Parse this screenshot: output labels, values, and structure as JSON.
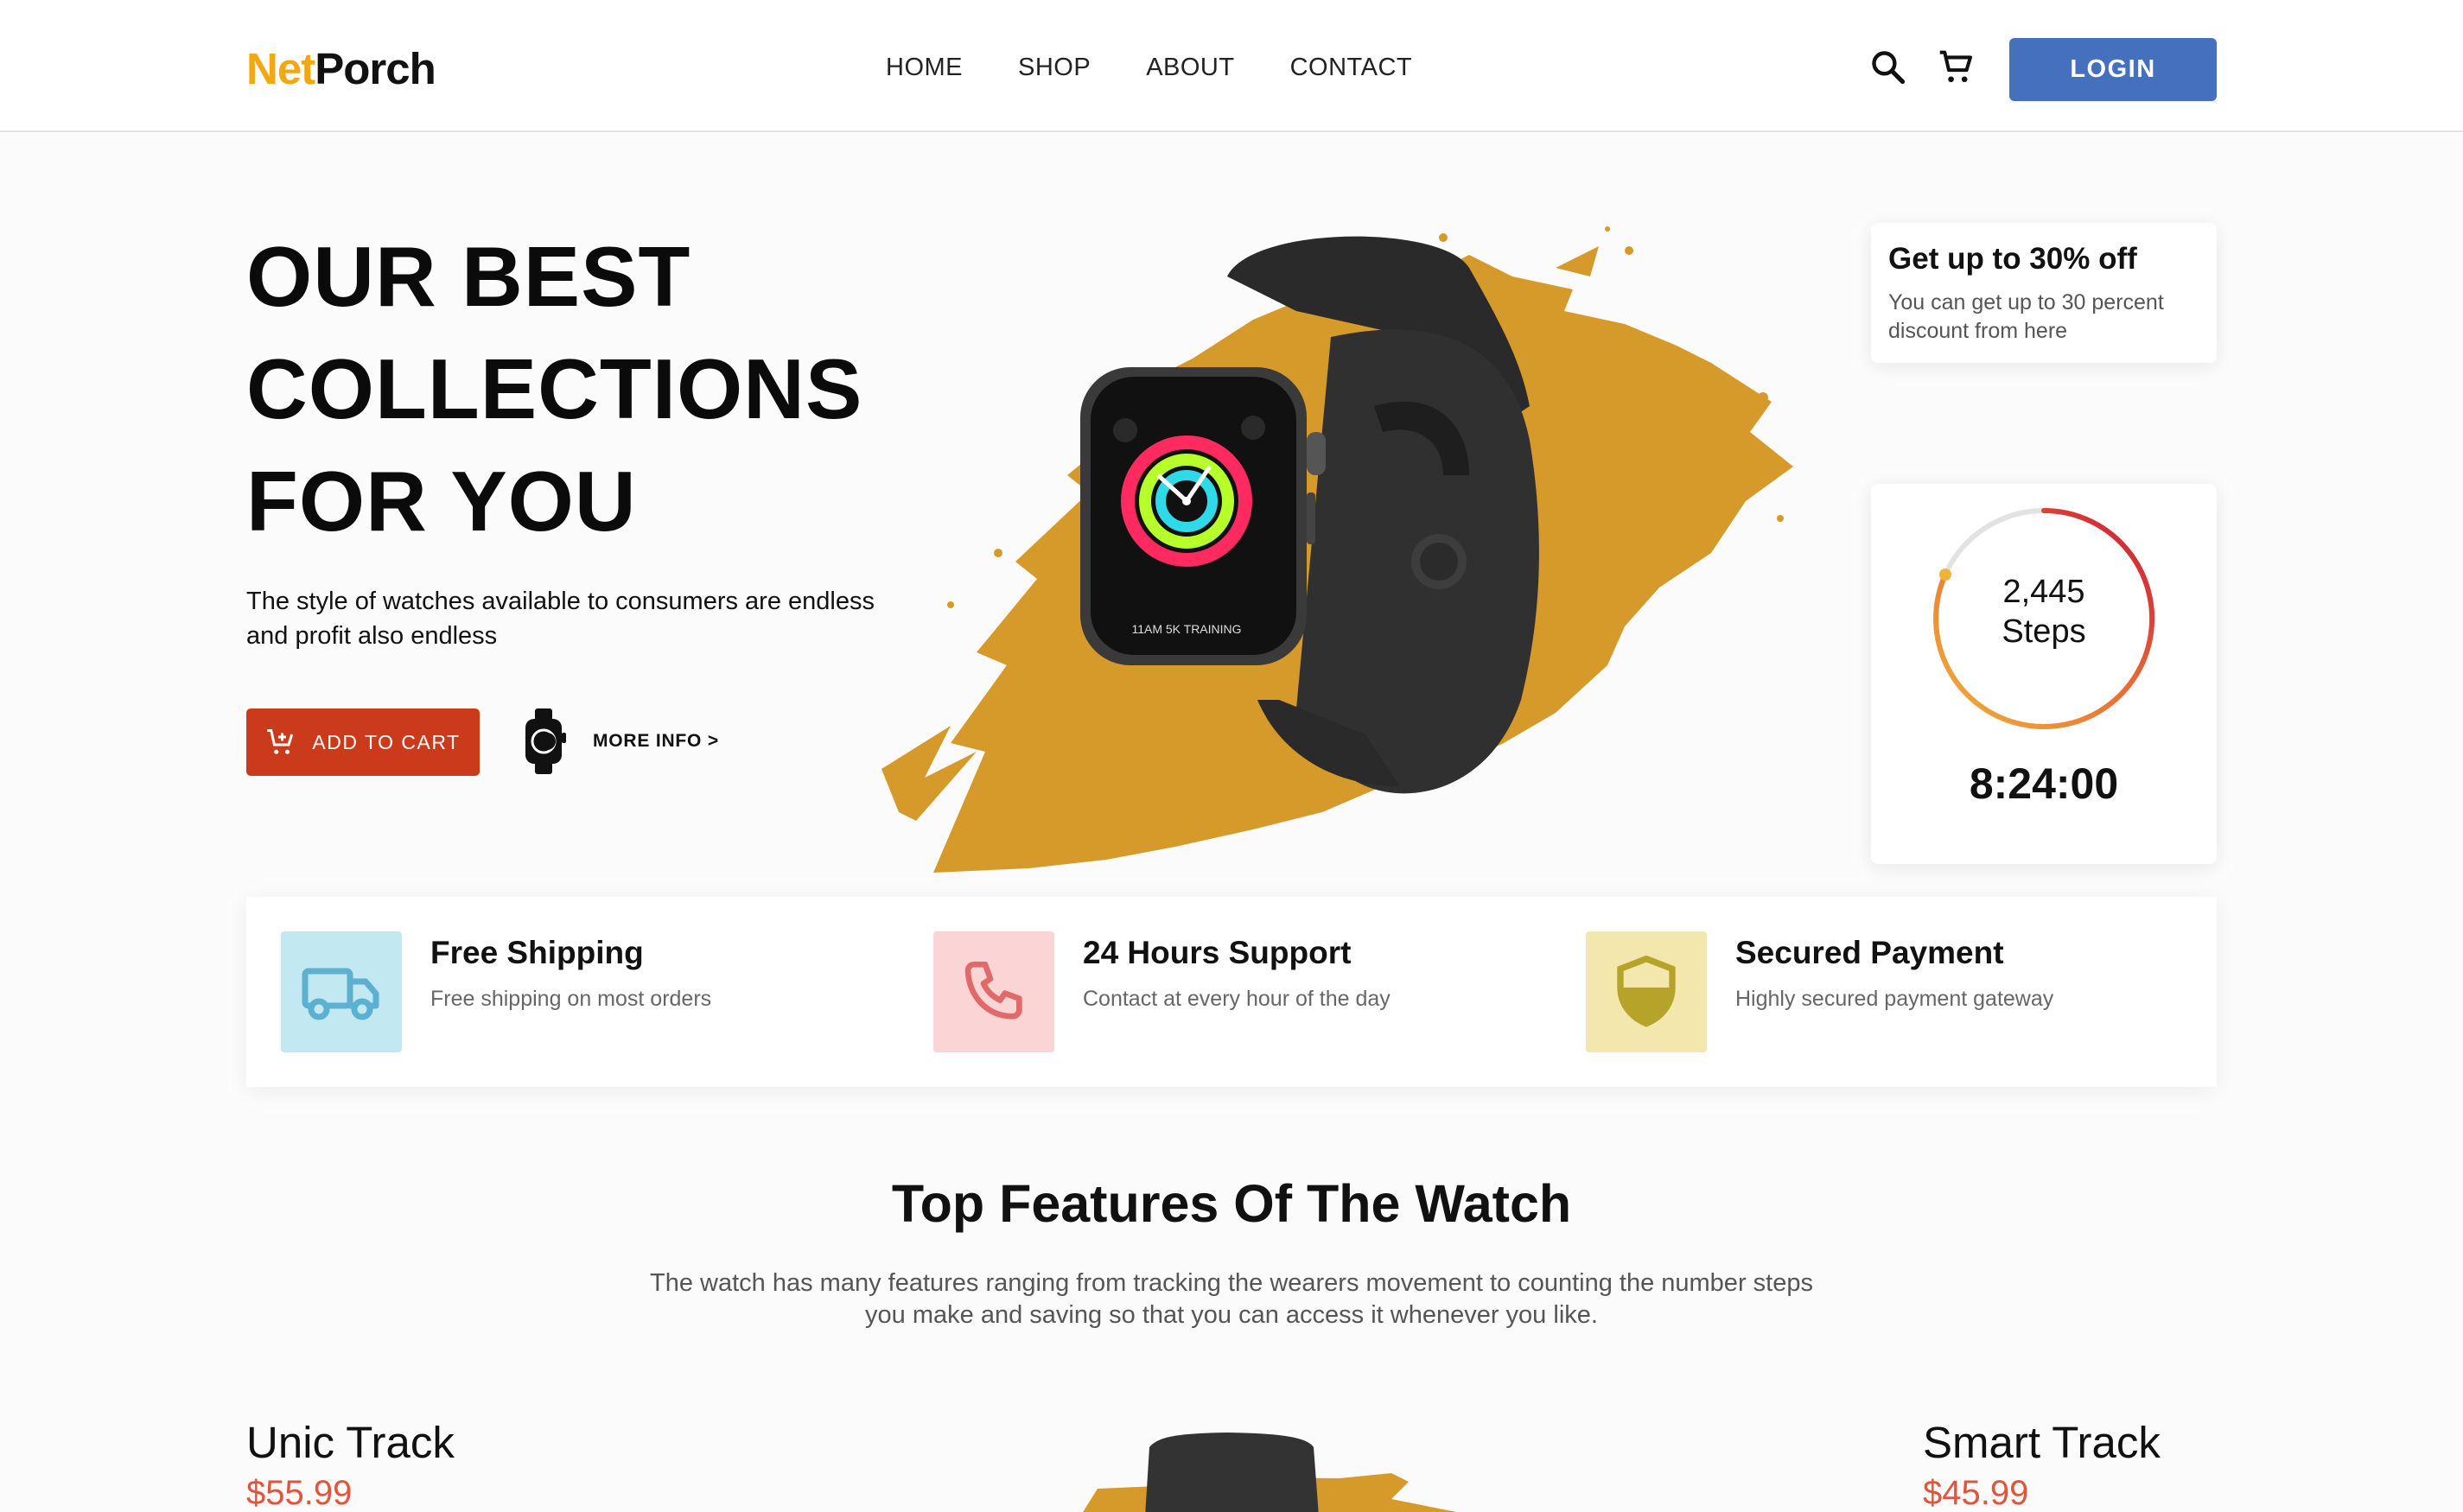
{
  "brand": {
    "part1": "Net",
    "part2": "Porch",
    "accent_color": "#f3a712"
  },
  "nav": {
    "items": [
      "HOME",
      "SHOP",
      "ABOUT",
      "CONTACT"
    ]
  },
  "header": {
    "search_icon": "search-icon",
    "cart_icon": "cart-icon",
    "login_label": "LOGIN",
    "login_color": "#4470bd"
  },
  "hero": {
    "title_lines": [
      "OUR BEST",
      "COLLECTIONS",
      "FOR YOU"
    ],
    "subtitle": "The style of watches available to consumers are endless and profit also endless",
    "cart_button": "ADD TO CART",
    "cart_button_color": "#cc3a1c",
    "more_info": "MORE INFO >",
    "watch_face_text": "11AM 5K TRAINING"
  },
  "promo": {
    "title": "Get up to 30% off",
    "text": "You can get up to 30 percent discount from here"
  },
  "steps": {
    "count": "2,445",
    "label": "Steps",
    "timer": "8:24:00"
  },
  "features": [
    {
      "title": "Free Shipping",
      "desc": "Free shipping on most orders",
      "icon": "truck-icon",
      "bg": "#c2e9f1",
      "fg": "#5cb0d0"
    },
    {
      "title": "24 Hours Support",
      "desc": "Contact at every hour of the day",
      "icon": "phone-icon",
      "bg": "#fbd5d5",
      "fg": "#e06a6a"
    },
    {
      "title": "Secured Payment",
      "desc": "Highly secured payment gateway",
      "icon": "shield-icon",
      "bg": "#f3e7ad",
      "fg": "#b5a32a"
    }
  ],
  "section": {
    "title": "Top Features Of The Watch",
    "desc": "The watch has many features ranging from tracking the wearers movement to counting the number steps you make and saving so that you can access it whenever you like."
  },
  "products": [
    {
      "name": "Unic Track",
      "price": "$55.99"
    },
    {
      "name": "Smart Track",
      "price": "$45.99"
    }
  ]
}
